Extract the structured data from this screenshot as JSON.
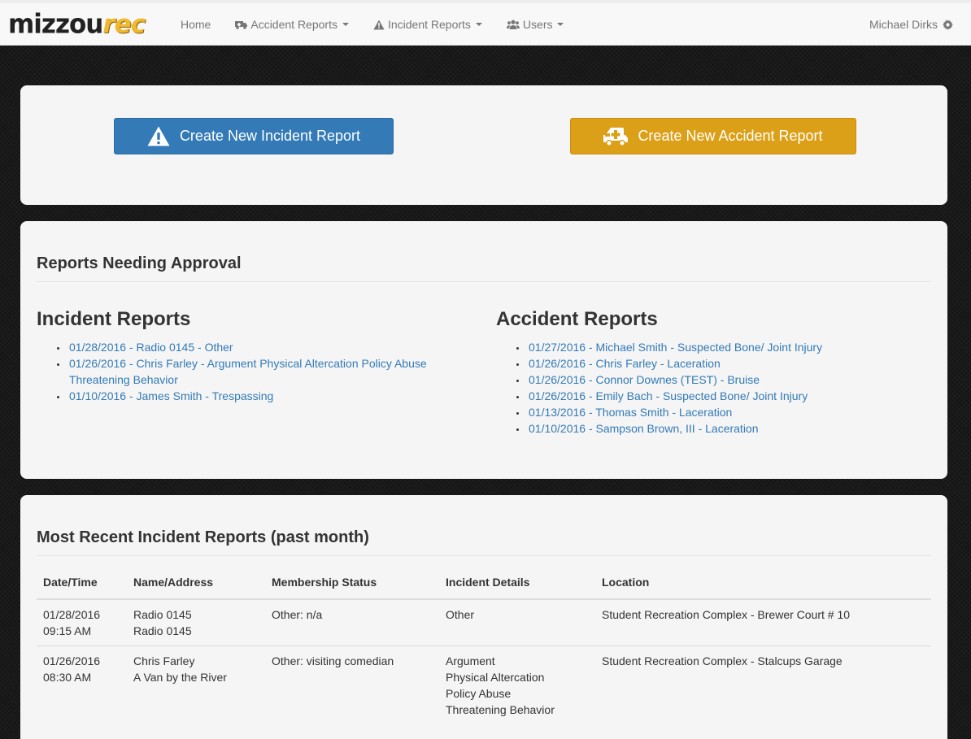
{
  "navbar": {
    "brand": {
      "part1": "mizzou",
      "part2": "rec"
    },
    "items": [
      {
        "label": "Home"
      },
      {
        "label": "Accident Reports"
      },
      {
        "label": "Incident Reports"
      },
      {
        "label": "Users"
      }
    ],
    "user": "Michael Dirks"
  },
  "actions": {
    "incident_button": "Create New Incident Report",
    "accident_button": "Create New Accident Report"
  },
  "approval": {
    "title": "Reports Needing Approval",
    "incident_title": "Incident Reports",
    "accident_title": "Accident Reports",
    "incident_reports": [
      "01/28/2016 - Radio 0145 - Other",
      "01/26/2016 - Chris Farley - Argument Physical Altercation Policy Abuse Threatening Behavior",
      "01/10/2016 - James Smith - Trespassing"
    ],
    "accident_reports": [
      "01/27/2016 - Michael Smith - Suspected Bone/ Joint Injury",
      "01/26/2016 - Chris Farley - Laceration",
      "01/26/2016 - Connor Downes (TEST) - Bruise",
      "01/26/2016 - Emily Bach - Suspected Bone/ Joint Injury",
      "01/13/2016 - Thomas Smith - Laceration",
      "01/10/2016 - Sampson Brown, III - Laceration"
    ]
  },
  "recent": {
    "title": "Most Recent Incident Reports (past month)",
    "columns": [
      "Date/Time",
      "Name/Address",
      "Membership Status",
      "Incident Details",
      "Location"
    ],
    "rows": [
      {
        "date": "01/28/2016",
        "time": "09:15 AM",
        "name": "Radio 0145",
        "address": "Radio 0145",
        "membership": "Other: n/a",
        "details": [
          "Other"
        ],
        "location": "Student Recreation Complex - Brewer Court # 10"
      },
      {
        "date": "01/26/2016",
        "time": "08:30 AM",
        "name": "Chris Farley",
        "address": "A Van by the River",
        "membership": "Other: visiting comedian",
        "details": [
          "Argument",
          "Physical Altercation",
          "Policy Abuse",
          "Threatening Behavior"
        ],
        "location": "Student Recreation Complex - Stalcups Garage"
      }
    ]
  }
}
